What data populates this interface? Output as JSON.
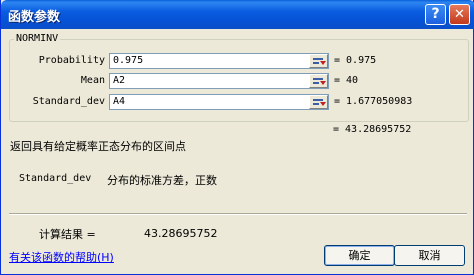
{
  "window": {
    "title": "函数参数",
    "help_button": "?",
    "close_button": "✕"
  },
  "function_name": "NORMINV",
  "arguments": [
    {
      "label": "Probability",
      "value": "0.975",
      "result": "= 0.975"
    },
    {
      "label": "Mean",
      "value": "A2",
      "result": "= 40"
    },
    {
      "label": "Standard_dev",
      "value": "A4",
      "result": "= 1.677050983"
    }
  ],
  "formula_result_preview": "= 43.28695752",
  "description": "返回具有给定概率正态分布的区间点",
  "arg_help": {
    "name": "Standard_dev",
    "text": "分布的标准方差，正数"
  },
  "calc_result": {
    "label": "计算结果 =",
    "value": "43.28695752"
  },
  "help_link": "有关该函数的帮助(H)",
  "buttons": {
    "ok": "确定",
    "cancel": "取消"
  }
}
